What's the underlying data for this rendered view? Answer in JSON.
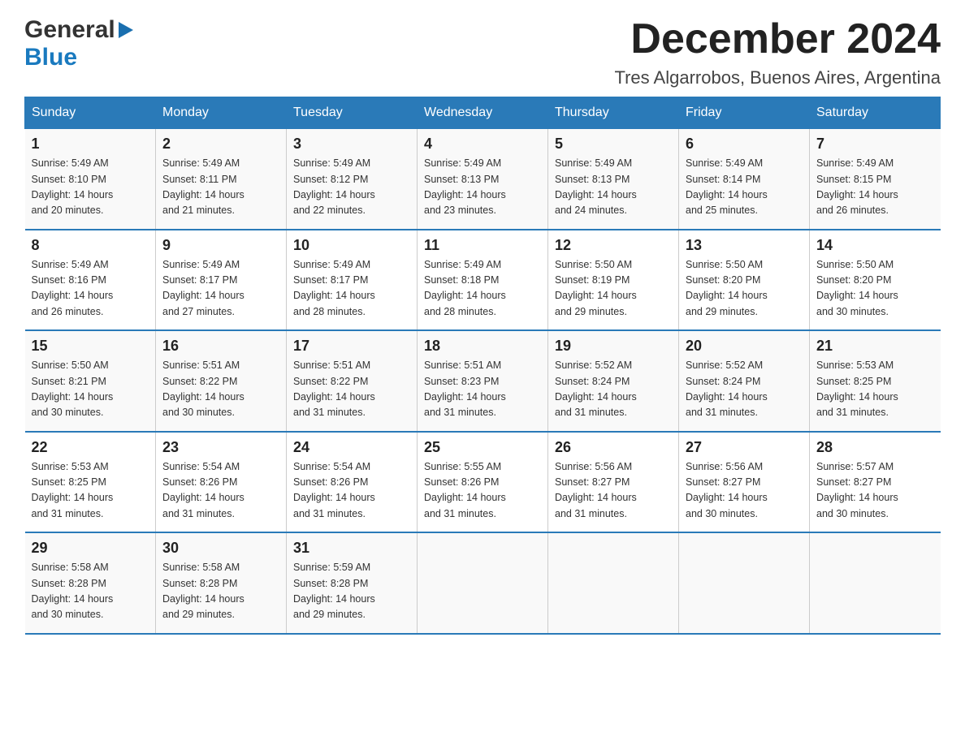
{
  "logo": {
    "general": "General",
    "blue": "Blue",
    "triangle": "▶"
  },
  "title": "December 2024",
  "subtitle": "Tres Algarrobos, Buenos Aires, Argentina",
  "days_of_week": [
    "Sunday",
    "Monday",
    "Tuesday",
    "Wednesday",
    "Thursday",
    "Friday",
    "Saturday"
  ],
  "weeks": [
    [
      {
        "day": "1",
        "sunrise": "5:49 AM",
        "sunset": "8:10 PM",
        "daylight": "14 hours and 20 minutes."
      },
      {
        "day": "2",
        "sunrise": "5:49 AM",
        "sunset": "8:11 PM",
        "daylight": "14 hours and 21 minutes."
      },
      {
        "day": "3",
        "sunrise": "5:49 AM",
        "sunset": "8:12 PM",
        "daylight": "14 hours and 22 minutes."
      },
      {
        "day": "4",
        "sunrise": "5:49 AM",
        "sunset": "8:13 PM",
        "daylight": "14 hours and 23 minutes."
      },
      {
        "day": "5",
        "sunrise": "5:49 AM",
        "sunset": "8:13 PM",
        "daylight": "14 hours and 24 minutes."
      },
      {
        "day": "6",
        "sunrise": "5:49 AM",
        "sunset": "8:14 PM",
        "daylight": "14 hours and 25 minutes."
      },
      {
        "day": "7",
        "sunrise": "5:49 AM",
        "sunset": "8:15 PM",
        "daylight": "14 hours and 26 minutes."
      }
    ],
    [
      {
        "day": "8",
        "sunrise": "5:49 AM",
        "sunset": "8:16 PM",
        "daylight": "14 hours and 26 minutes."
      },
      {
        "day": "9",
        "sunrise": "5:49 AM",
        "sunset": "8:17 PM",
        "daylight": "14 hours and 27 minutes."
      },
      {
        "day": "10",
        "sunrise": "5:49 AM",
        "sunset": "8:17 PM",
        "daylight": "14 hours and 28 minutes."
      },
      {
        "day": "11",
        "sunrise": "5:49 AM",
        "sunset": "8:18 PM",
        "daylight": "14 hours and 28 minutes."
      },
      {
        "day": "12",
        "sunrise": "5:50 AM",
        "sunset": "8:19 PM",
        "daylight": "14 hours and 29 minutes."
      },
      {
        "day": "13",
        "sunrise": "5:50 AM",
        "sunset": "8:20 PM",
        "daylight": "14 hours and 29 minutes."
      },
      {
        "day": "14",
        "sunrise": "5:50 AM",
        "sunset": "8:20 PM",
        "daylight": "14 hours and 30 minutes."
      }
    ],
    [
      {
        "day": "15",
        "sunrise": "5:50 AM",
        "sunset": "8:21 PM",
        "daylight": "14 hours and 30 minutes."
      },
      {
        "day": "16",
        "sunrise": "5:51 AM",
        "sunset": "8:22 PM",
        "daylight": "14 hours and 30 minutes."
      },
      {
        "day": "17",
        "sunrise": "5:51 AM",
        "sunset": "8:22 PM",
        "daylight": "14 hours and 31 minutes."
      },
      {
        "day": "18",
        "sunrise": "5:51 AM",
        "sunset": "8:23 PM",
        "daylight": "14 hours and 31 minutes."
      },
      {
        "day": "19",
        "sunrise": "5:52 AM",
        "sunset": "8:24 PM",
        "daylight": "14 hours and 31 minutes."
      },
      {
        "day": "20",
        "sunrise": "5:52 AM",
        "sunset": "8:24 PM",
        "daylight": "14 hours and 31 minutes."
      },
      {
        "day": "21",
        "sunrise": "5:53 AM",
        "sunset": "8:25 PM",
        "daylight": "14 hours and 31 minutes."
      }
    ],
    [
      {
        "day": "22",
        "sunrise": "5:53 AM",
        "sunset": "8:25 PM",
        "daylight": "14 hours and 31 minutes."
      },
      {
        "day": "23",
        "sunrise": "5:54 AM",
        "sunset": "8:26 PM",
        "daylight": "14 hours and 31 minutes."
      },
      {
        "day": "24",
        "sunrise": "5:54 AM",
        "sunset": "8:26 PM",
        "daylight": "14 hours and 31 minutes."
      },
      {
        "day": "25",
        "sunrise": "5:55 AM",
        "sunset": "8:26 PM",
        "daylight": "14 hours and 31 minutes."
      },
      {
        "day": "26",
        "sunrise": "5:56 AM",
        "sunset": "8:27 PM",
        "daylight": "14 hours and 31 minutes."
      },
      {
        "day": "27",
        "sunrise": "5:56 AM",
        "sunset": "8:27 PM",
        "daylight": "14 hours and 30 minutes."
      },
      {
        "day": "28",
        "sunrise": "5:57 AM",
        "sunset": "8:27 PM",
        "daylight": "14 hours and 30 minutes."
      }
    ],
    [
      {
        "day": "29",
        "sunrise": "5:58 AM",
        "sunset": "8:28 PM",
        "daylight": "14 hours and 30 minutes."
      },
      {
        "day": "30",
        "sunrise": "5:58 AM",
        "sunset": "8:28 PM",
        "daylight": "14 hours and 29 minutes."
      },
      {
        "day": "31",
        "sunrise": "5:59 AM",
        "sunset": "8:28 PM",
        "daylight": "14 hours and 29 minutes."
      },
      null,
      null,
      null,
      null
    ]
  ],
  "labels": {
    "sunrise": "Sunrise:",
    "sunset": "Sunset:",
    "daylight": "Daylight:"
  }
}
